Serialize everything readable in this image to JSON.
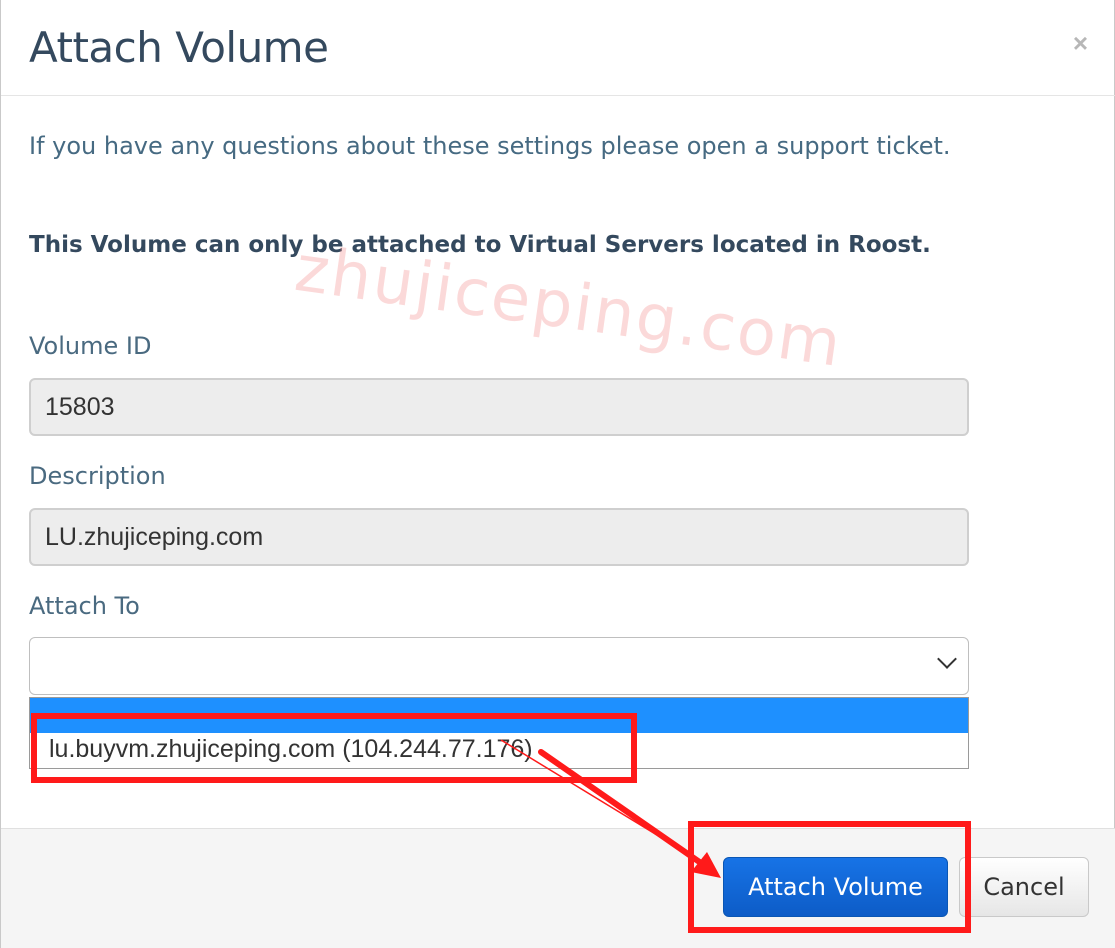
{
  "dialog": {
    "title": "Attach Volume",
    "close_symbol": "×"
  },
  "body": {
    "intro_text": "If you have any questions about these settings please open a support ticket.",
    "notice_text": "This Volume can only be attached to Virtual Servers located in Roost.",
    "watermark": "zhujiceping.com"
  },
  "fields": {
    "volume_id": {
      "label": "Volume ID",
      "value": "15803"
    },
    "description": {
      "label": "Description",
      "value": "LU.zhujiceping.com"
    },
    "attach_to": {
      "label": "Attach To",
      "selected": "",
      "options": [
        "",
        "lu.buyvm.zhujiceping.com (104.244.77.176)"
      ]
    }
  },
  "footer": {
    "attach_label": "Attach Volume",
    "cancel_label": "Cancel"
  },
  "colors": {
    "primary": "#0d5cc7",
    "dropdown_highlight": "#1e90ff",
    "annotation_red": "#ff1a1a"
  },
  "icons": {
    "close": "close-icon",
    "chevron": "chevron-down-icon"
  }
}
